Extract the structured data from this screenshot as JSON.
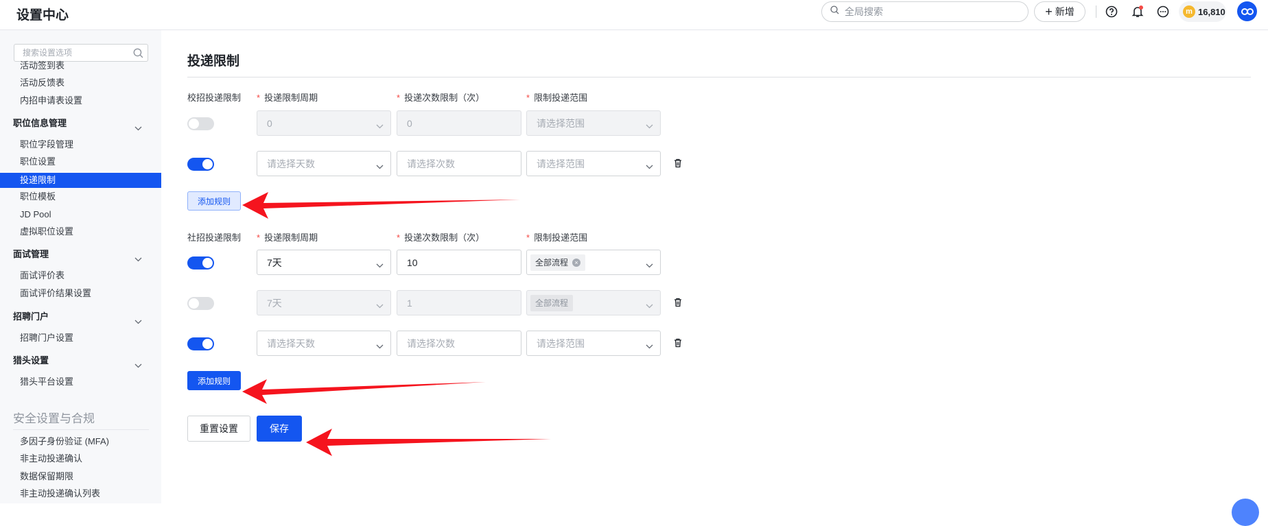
{
  "app": {
    "title": "设置中心"
  },
  "topbar": {
    "search_placeholder": "全局搜索",
    "new_label": "新增",
    "coins": "16,810",
    "coin_glyph": "m"
  },
  "sidebar": {
    "search_placeholder": "搜索设置选项",
    "items_top": [
      "活动签到表",
      "活动反馈表",
      "内招申请表设置"
    ],
    "groups": [
      {
        "title": "职位信息管理",
        "items": [
          "职位字段管理",
          "职位设置",
          "投递限制",
          "职位模板",
          "JD Pool",
          "虚拟职位设置"
        ]
      },
      {
        "title": "面试管理",
        "items": [
          "面试评价表",
          "面试评价结果设置"
        ]
      },
      {
        "title": "招聘门户",
        "items": [
          "招聘门户设置"
        ]
      },
      {
        "title": "猎头设置",
        "items": [
          "猎头平台设置"
        ]
      }
    ],
    "section": {
      "title": "安全设置与合规",
      "items": [
        "多因子身份验证 (MFA)",
        "非主动投递确认",
        "数据保留期限",
        "非主动投递确认列表"
      ]
    }
  },
  "page": {
    "title": "投递限制",
    "columns": {
      "period": "投递限制周期",
      "count": "投递次数限制（次）",
      "scope": "限制投递范围"
    },
    "campus": {
      "label": "校招投递限制",
      "rows": [
        {
          "enabled": false,
          "period": "0",
          "count": "0",
          "scope": "请选择范围"
        },
        {
          "enabled": true,
          "period": "请选择天数",
          "count": "请选择次数",
          "scope": "请选择范围"
        }
      ],
      "add_rule": "添加规则"
    },
    "social": {
      "label": "社招投递限制",
      "rows": [
        {
          "enabled": true,
          "period": "7天",
          "count": "10",
          "scope": "全部流程"
        },
        {
          "enabled": false,
          "period": "7天",
          "count": "1",
          "scope": "全部流程"
        },
        {
          "enabled": true,
          "period": "请选择天数",
          "count": "请选择次数",
          "scope": "请选择范围"
        }
      ],
      "add_rule": "添加规则"
    },
    "buttons": {
      "reset": "重置设置",
      "save": "保存"
    }
  },
  "colors": {
    "primary": "#1456f0",
    "required": "#f54a45",
    "annotation_arrow": "#f5141e"
  }
}
